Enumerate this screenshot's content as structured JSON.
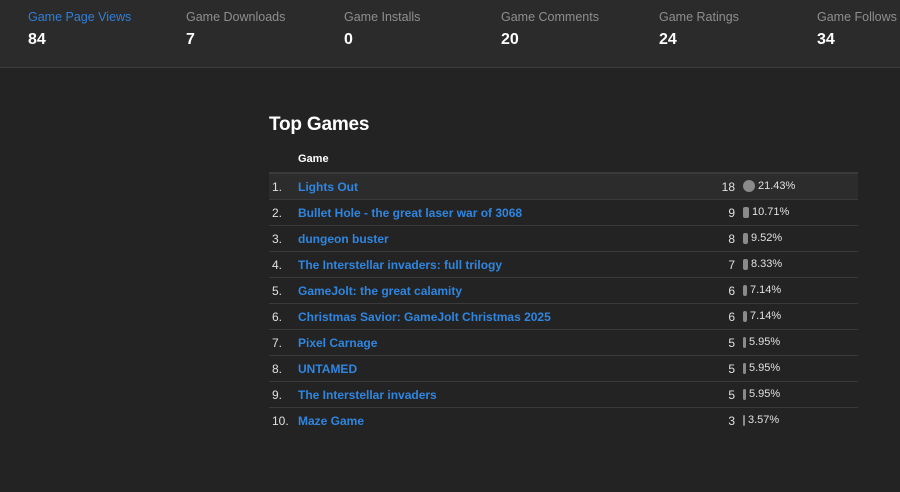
{
  "stats": [
    {
      "label": "Game Page Views",
      "value": "84"
    },
    {
      "label": "Game Downloads",
      "value": "7"
    },
    {
      "label": "Game Installs",
      "value": "0"
    },
    {
      "label": "Game Comments",
      "value": "20"
    },
    {
      "label": "Game Ratings",
      "value": "24"
    },
    {
      "label": "Game Follows",
      "value": "34"
    }
  ],
  "colors": {
    "accent": "#2f86e0",
    "background": "#232323",
    "bar": "#8a8a8a"
  },
  "top_games": {
    "title": "Top Games",
    "column_header": "Game",
    "rows": [
      {
        "rank": "1.",
        "name": "Lights Out",
        "count": "18",
        "pct": "21.43%",
        "pct_value": 21.43
      },
      {
        "rank": "2.",
        "name": "Bullet Hole - the great laser war of 3068",
        "count": "9",
        "pct": "10.71%",
        "pct_value": 10.71
      },
      {
        "rank": "3.",
        "name": "dungeon buster",
        "count": "8",
        "pct": "9.52%",
        "pct_value": 9.52
      },
      {
        "rank": "4.",
        "name": "The Interstellar invaders: full trilogy",
        "count": "7",
        "pct": "8.33%",
        "pct_value": 8.33
      },
      {
        "rank": "5.",
        "name": "GameJolt: the great calamity",
        "count": "6",
        "pct": "7.14%",
        "pct_value": 7.14
      },
      {
        "rank": "6.",
        "name": "Christmas Savior: GameJolt Christmas 2025",
        "count": "6",
        "pct": "7.14%",
        "pct_value": 7.14
      },
      {
        "rank": "7.",
        "name": "Pixel Carnage",
        "count": "5",
        "pct": "5.95%",
        "pct_value": 5.95
      },
      {
        "rank": "8.",
        "name": "UNTAMED",
        "count": "5",
        "pct": "5.95%",
        "pct_value": 5.95
      },
      {
        "rank": "9.",
        "name": "The Interstellar invaders",
        "count": "5",
        "pct": "5.95%",
        "pct_value": 5.95
      },
      {
        "rank": "10.",
        "name": "Maze Game",
        "count": "3",
        "pct": "3.57%",
        "pct_value": 3.57
      }
    ]
  }
}
